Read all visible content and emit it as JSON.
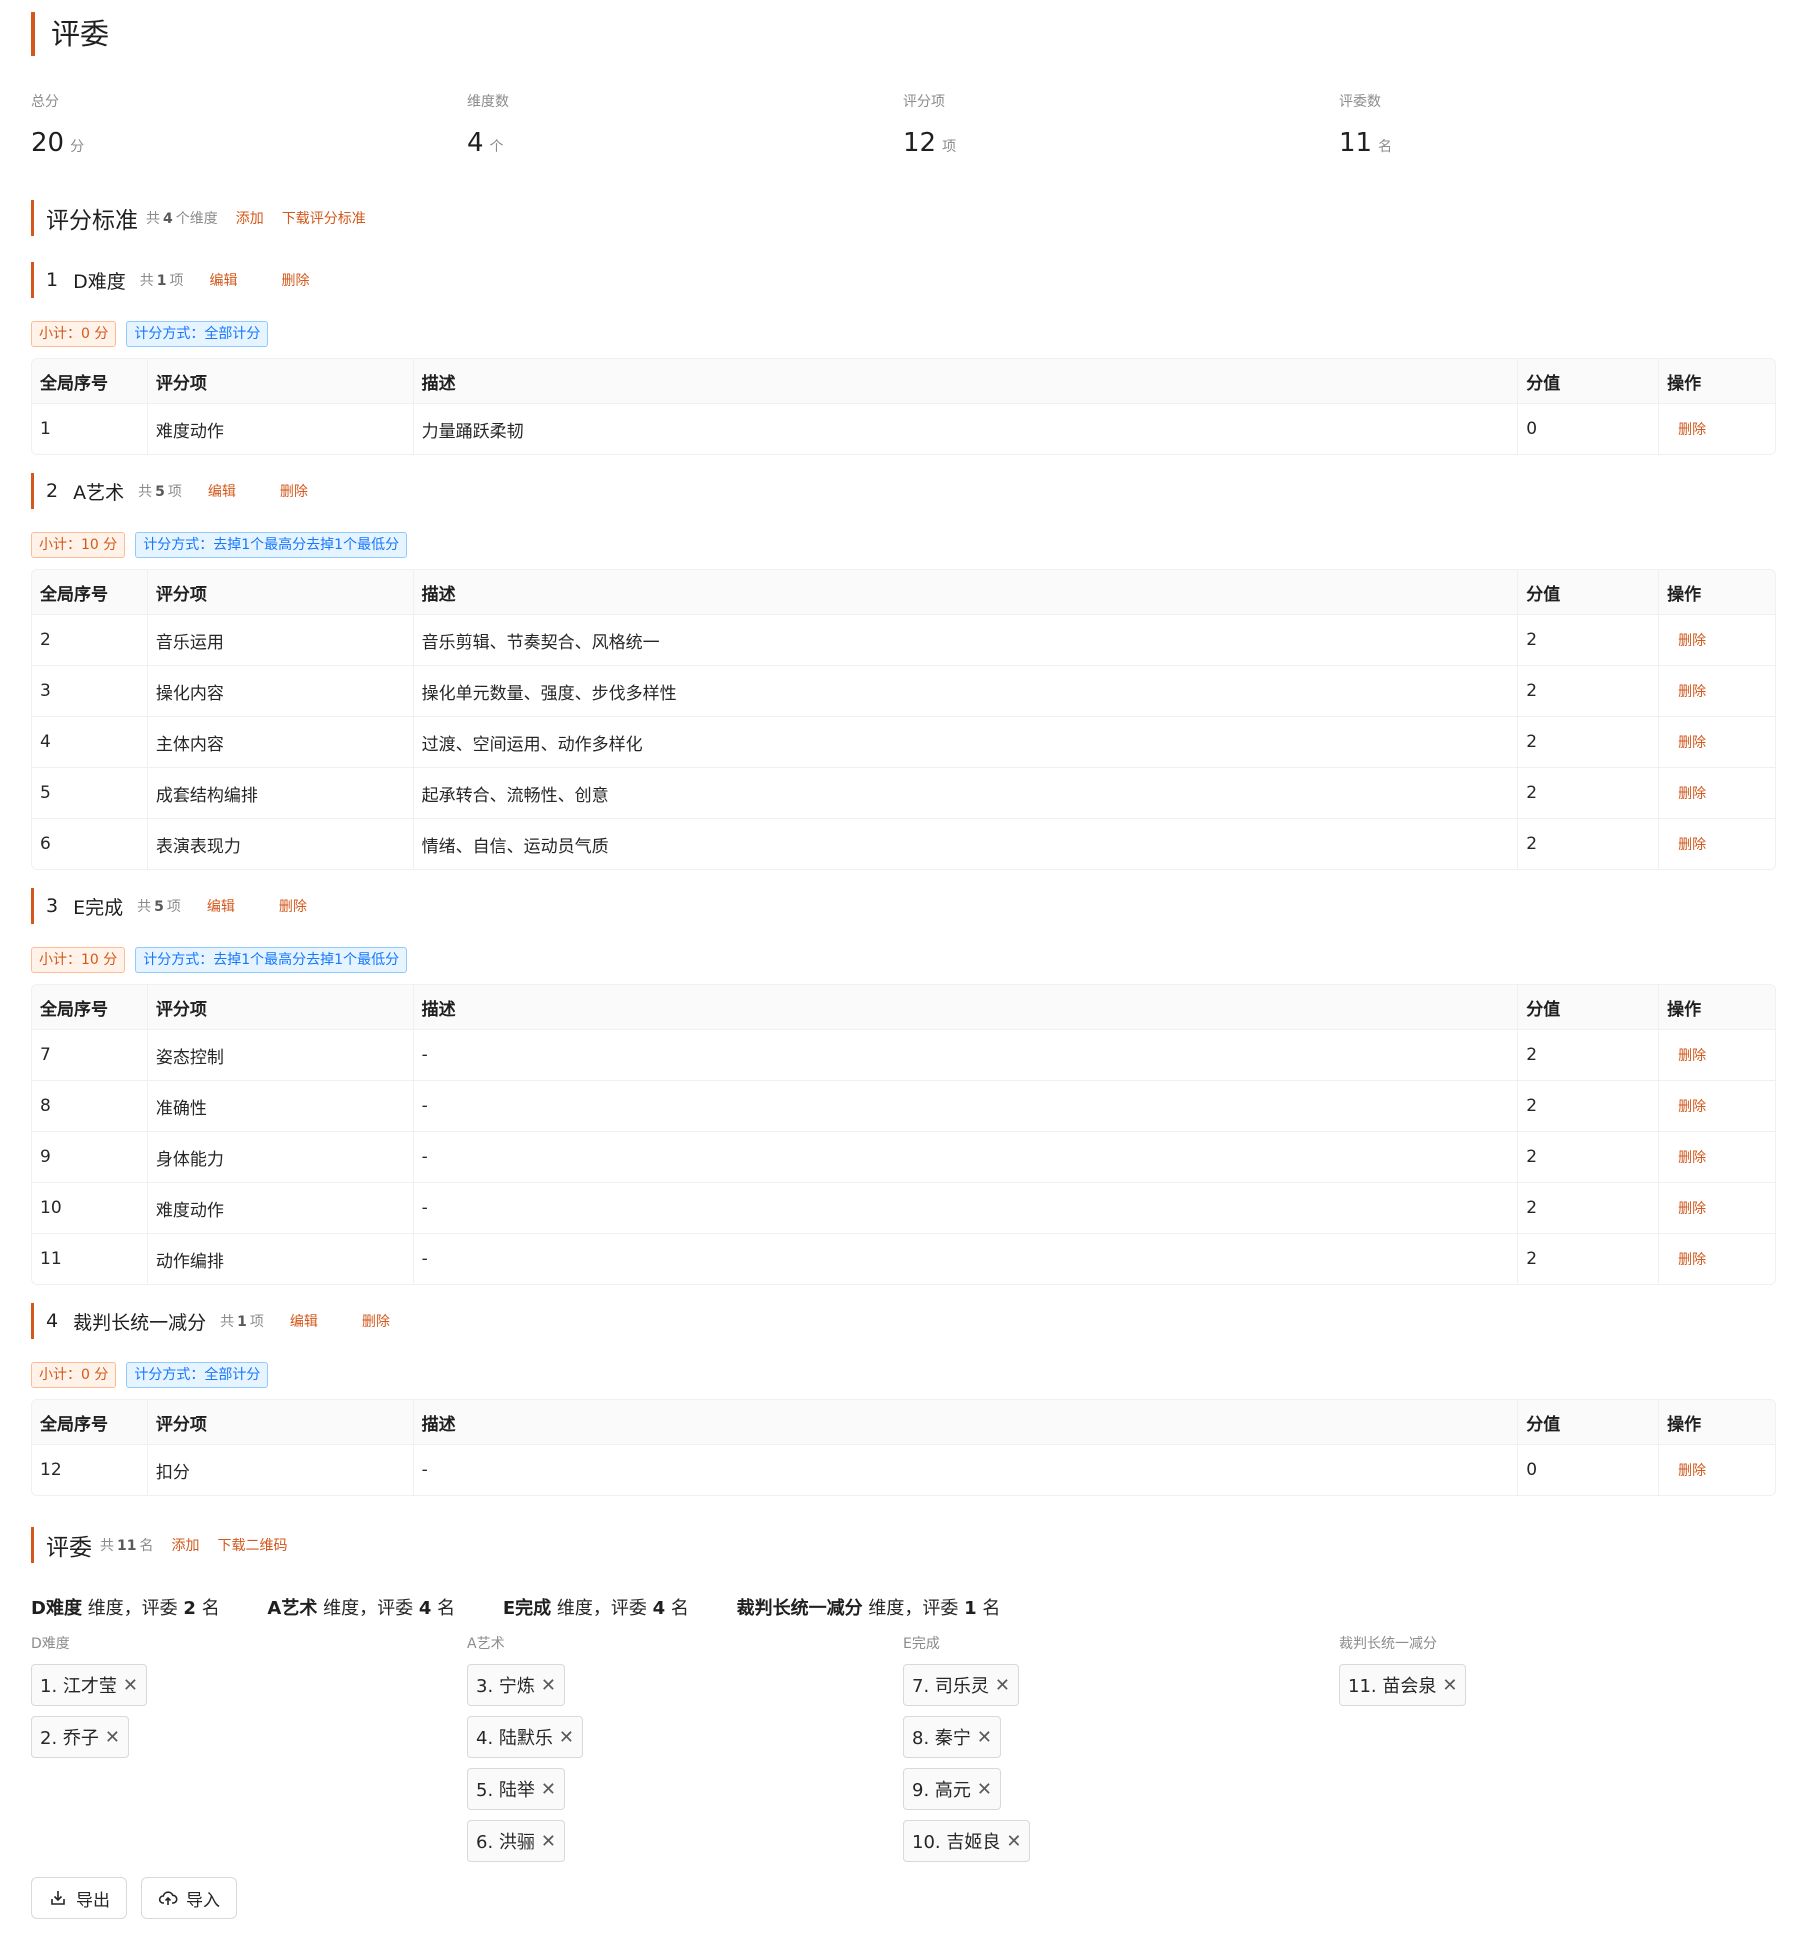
{
  "page": {
    "title": "评委"
  },
  "stats": [
    {
      "label": "总分",
      "value": "20",
      "unit": "分"
    },
    {
      "label": "维度数",
      "value": "4",
      "unit": "个"
    },
    {
      "label": "评分项",
      "value": "12",
      "unit": "项"
    },
    {
      "label": "评委数",
      "value": "11",
      "unit": "名"
    }
  ],
  "criteria": {
    "title": "评分标准",
    "count_prefix": "共",
    "count": "4",
    "count_suffix": "个维度",
    "add_label": "添加",
    "download_label": "下载评分标准"
  },
  "table_headers": {
    "index": "全局序号",
    "item": "评分项",
    "desc": "描述",
    "score": "分值",
    "action": "操作"
  },
  "dimensions": [
    {
      "num": "1",
      "name": "D难度",
      "count_prefix": "共",
      "count": "1",
      "count_suffix": "项",
      "edit_label": "编辑",
      "delete_label": "删除",
      "subtotal": "小计：0 分",
      "method": "计分方式：全部计分",
      "rows": [
        {
          "index": "1",
          "item": "难度动作",
          "desc": "力量踊跃柔韧",
          "score": "0",
          "action": "删除"
        }
      ]
    },
    {
      "num": "2",
      "name": "A艺术",
      "count_prefix": "共",
      "count": "5",
      "count_suffix": "项",
      "edit_label": "编辑",
      "delete_label": "删除",
      "subtotal": "小计：10 分",
      "method": "计分方式：去掉1个最高分去掉1个最低分",
      "rows": [
        {
          "index": "2",
          "item": "音乐运用",
          "desc": "音乐剪辑、节奏契合、风格统一",
          "score": "2",
          "action": "删除"
        },
        {
          "index": "3",
          "item": "操化内容",
          "desc": "操化单元数量、强度、步伐多样性",
          "score": "2",
          "action": "删除"
        },
        {
          "index": "4",
          "item": "主体内容",
          "desc": "过渡、空间运用、动作多样化",
          "score": "2",
          "action": "删除"
        },
        {
          "index": "5",
          "item": "成套结构编排",
          "desc": "起承转合、流畅性、创意",
          "score": "2",
          "action": "删除"
        },
        {
          "index": "6",
          "item": "表演表现力",
          "desc": "情绪、自信、运动员气质",
          "score": "2",
          "action": "删除"
        }
      ]
    },
    {
      "num": "3",
      "name": "E完成",
      "count_prefix": "共",
      "count": "5",
      "count_suffix": "项",
      "edit_label": "编辑",
      "delete_label": "删除",
      "subtotal": "小计：10 分",
      "method": "计分方式：去掉1个最高分去掉1个最低分",
      "rows": [
        {
          "index": "7",
          "item": "姿态控制",
          "desc": "-",
          "score": "2",
          "action": "删除"
        },
        {
          "index": "8",
          "item": "准确性",
          "desc": "-",
          "score": "2",
          "action": "删除"
        },
        {
          "index": "9",
          "item": "身体能力",
          "desc": "-",
          "score": "2",
          "action": "删除"
        },
        {
          "index": "10",
          "item": "难度动作",
          "desc": "-",
          "score": "2",
          "action": "删除"
        },
        {
          "index": "11",
          "item": "动作编排",
          "desc": "-",
          "score": "2",
          "action": "删除"
        }
      ]
    },
    {
      "num": "4",
      "name": "裁判长统一减分",
      "count_prefix": "共",
      "count": "1",
      "count_suffix": "项",
      "edit_label": "编辑",
      "delete_label": "删除",
      "subtotal": "小计：0 分",
      "method": "计分方式：全部计分",
      "rows": [
        {
          "index": "12",
          "item": "扣分",
          "desc": "-",
          "score": "0",
          "action": "删除"
        }
      ]
    }
  ],
  "judges": {
    "title": "评委",
    "count_prefix": "共",
    "count": "11",
    "count_suffix": "名",
    "add_label": "添加",
    "download_label": "下载二维码",
    "summary": [
      {
        "dim": "D难度",
        "mid": "维度，评委",
        "num": "2",
        "unit": "名"
      },
      {
        "dim": "A艺术",
        "mid": "维度，评委",
        "num": "4",
        "unit": "名"
      },
      {
        "dim": "E完成",
        "mid": "维度，评委",
        "num": "4",
        "unit": "名"
      },
      {
        "dim": "裁判长统一减分",
        "mid": "维度，评委",
        "num": "1",
        "unit": "名"
      }
    ],
    "columns": [
      {
        "label": "D难度",
        "members": [
          "1. 江才莹",
          "2. 乔子"
        ]
      },
      {
        "label": "A艺术",
        "members": [
          "3. 宁炼",
          "4. 陆默乐",
          "5. 陆举",
          "6. 洪骊"
        ]
      },
      {
        "label": "E完成",
        "members": [
          "7. 司乐灵",
          "8. 秦宁",
          "9. 高元",
          "10. 吉姬良"
        ]
      },
      {
        "label": "裁判长统一减分",
        "members": [
          "11. 苗会泉"
        ]
      }
    ],
    "remove_glyph": "✕"
  },
  "actions": {
    "export_label": "导出",
    "import_label": "导入"
  },
  "colors": {
    "accent": "#d4581c",
    "tag_blue": "#1677ff",
    "border": "#f0f0f0"
  },
  "icons": {
    "export": "export-icon",
    "import": "cloud-upload-icon",
    "remove": "close-icon"
  }
}
